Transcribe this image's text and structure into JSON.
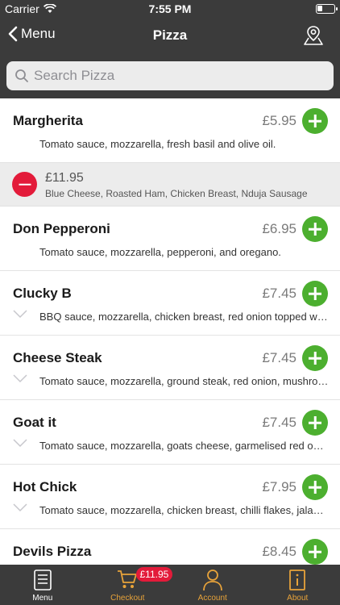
{
  "status_bar": {
    "carrier": "Carrier",
    "time": "7:55 PM"
  },
  "nav": {
    "back_label": "Menu",
    "title": "Pizza"
  },
  "search": {
    "placeholder": "Search Pizza"
  },
  "basket_item": {
    "price": "£11.95",
    "description": "Blue Cheese, Roasted Ham, Chicken Breast, Nduja Sausage"
  },
  "items": [
    {
      "name": "Margherita",
      "price": "£5.95",
      "description": "Tomato sauce, mozzarella, fresh basil and olive oil."
    },
    {
      "name": "Don Pepperoni",
      "price": "£6.95",
      "description": "Tomato sauce, mozzarella, pepperoni, and oregano."
    },
    {
      "name": "Clucky B",
      "price": "£7.45",
      "description": "BBQ sauce, mozzarella, chicken breast, red onion topped with sweetcorn."
    },
    {
      "name": "Cheese Steak",
      "price": "£7.45",
      "description": "Tomato sauce, mozzarella, ground steak, red onion, mushroom and peppers."
    },
    {
      "name": "Goat it",
      "price": "£7.45",
      "description": "Tomato sauce, mozzarella, goats cheese, garmelised red onion and spinach."
    },
    {
      "name": "Hot Chick",
      "price": "£7.95",
      "description": "Tomato sauce, mozzarella, chicken breast, chilli flakes, jalapenos."
    },
    {
      "name": "Devils Pizza",
      "price": "£8.45",
      "description": ""
    }
  ],
  "tabbar": {
    "menu_label": "Menu",
    "checkout_label": "Checkout",
    "checkout_badge": "£11.95",
    "account_label": "Account",
    "about_label": "About"
  },
  "colors": {
    "header_bg": "#3b3b3b",
    "add_green": "#4caf2f",
    "remove_red": "#e31b3a",
    "tab_accent": "#e8a33a"
  }
}
